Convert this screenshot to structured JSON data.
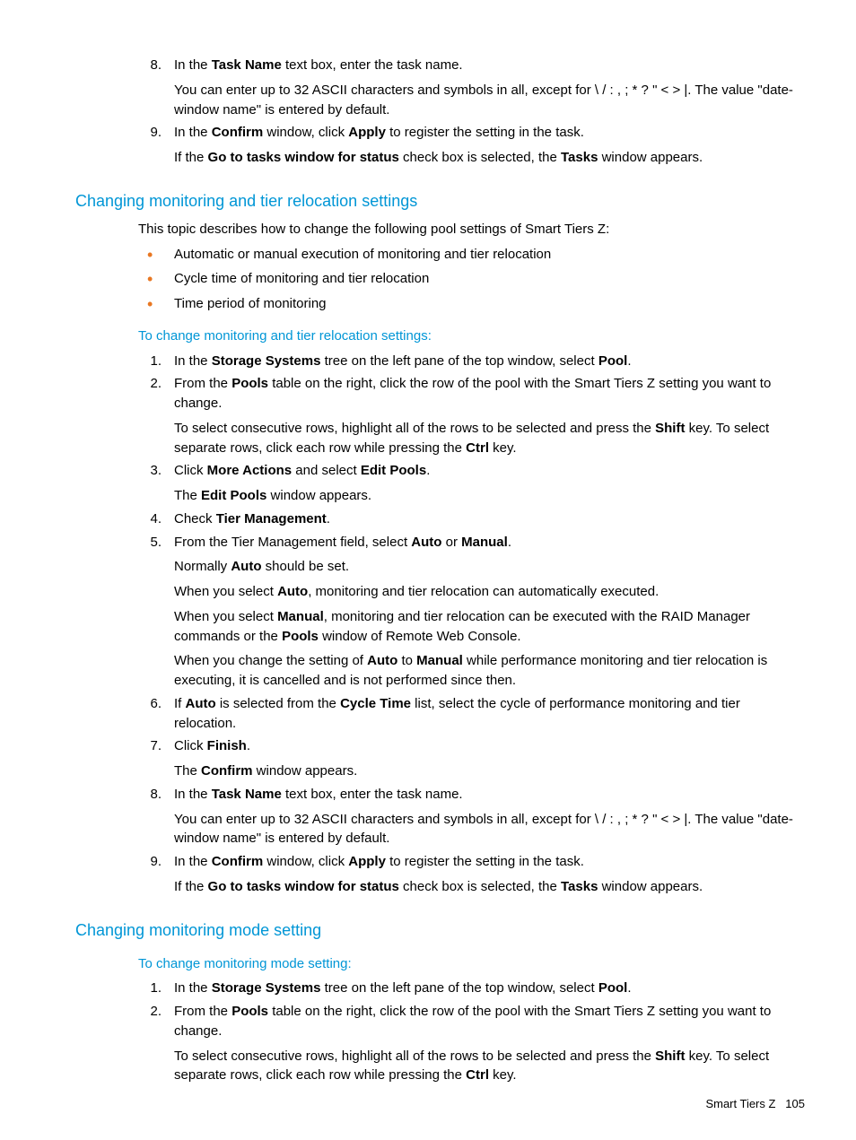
{
  "top_ol": [
    {
      "num": "8",
      "parts": [
        [
          {
            "t": "In the "
          },
          {
            "t": "Task Name",
            "b": true
          },
          {
            "t": " text box, enter the task name."
          }
        ],
        [
          {
            "t": "You can enter up to 32 ASCII characters and symbols in all, except for \\ / : , ; * ? \" < > |. The value \"date-window name\" is entered by default."
          }
        ]
      ]
    },
    {
      "num": "9",
      "parts": [
        [
          {
            "t": "In the "
          },
          {
            "t": "Confirm",
            "b": true
          },
          {
            "t": " window, click "
          },
          {
            "t": "Apply",
            "b": true
          },
          {
            "t": " to register the setting in the task."
          }
        ],
        [
          {
            "t": "If the "
          },
          {
            "t": "Go to tasks window for status",
            "b": true
          },
          {
            "t": " check box is selected, the "
          },
          {
            "t": "Tasks",
            "b": true
          },
          {
            "t": " window appears."
          }
        ]
      ]
    }
  ],
  "section1": {
    "heading": "Changing monitoring and tier relocation settings",
    "intro": "This topic describes how to change the following pool settings of Smart Tiers Z:",
    "bullets": [
      "Automatic or manual execution of monitoring and tier relocation",
      "Cycle time of monitoring and tier relocation",
      "Time period of monitoring"
    ],
    "subhead": "To change monitoring and tier relocation settings:",
    "ol": [
      {
        "num": "1",
        "parts": [
          [
            {
              "t": "In the "
            },
            {
              "t": "Storage Systems",
              "b": true
            },
            {
              "t": " tree on the left pane of the top window, select "
            },
            {
              "t": "Pool",
              "b": true
            },
            {
              "t": "."
            }
          ]
        ]
      },
      {
        "num": "2",
        "parts": [
          [
            {
              "t": "From the "
            },
            {
              "t": "Pools",
              "b": true
            },
            {
              "t": " table on the right, click the row of the pool with the Smart Tiers Z setting you want to change."
            }
          ],
          [
            {
              "t": "To select consecutive rows, highlight all of the rows to be selected and press the "
            },
            {
              "t": "Shift",
              "b": true
            },
            {
              "t": " key. To select separate rows, click each row while pressing the "
            },
            {
              "t": "Ctrl",
              "b": true
            },
            {
              "t": " key."
            }
          ]
        ]
      },
      {
        "num": "3",
        "parts": [
          [
            {
              "t": "Click "
            },
            {
              "t": "More Actions",
              "b": true
            },
            {
              "t": " and select "
            },
            {
              "t": "Edit Pools",
              "b": true
            },
            {
              "t": "."
            }
          ],
          [
            {
              "t": "The "
            },
            {
              "t": "Edit Pools",
              "b": true
            },
            {
              "t": " window appears."
            }
          ]
        ]
      },
      {
        "num": "4",
        "parts": [
          [
            {
              "t": "Check "
            },
            {
              "t": "Tier Management",
              "b": true
            },
            {
              "t": "."
            }
          ]
        ]
      },
      {
        "num": "5",
        "parts": [
          [
            {
              "t": "From the Tier Management field, select "
            },
            {
              "t": "Auto",
              "b": true
            },
            {
              "t": " or "
            },
            {
              "t": "Manual",
              "b": true
            },
            {
              "t": "."
            }
          ],
          [
            {
              "t": "Normally "
            },
            {
              "t": "Auto",
              "b": true
            },
            {
              "t": " should be set."
            }
          ],
          [
            {
              "t": "When you select "
            },
            {
              "t": "Auto",
              "b": true
            },
            {
              "t": ", monitoring and tier relocation can automatically executed."
            }
          ],
          [
            {
              "t": "When you select "
            },
            {
              "t": "Manual",
              "b": true
            },
            {
              "t": ", monitoring and tier relocation can be executed with the RAID Manager commands or the "
            },
            {
              "t": "Pools",
              "b": true
            },
            {
              "t": " window of Remote Web Console."
            }
          ],
          [
            {
              "t": "When you change the setting of "
            },
            {
              "t": "Auto",
              "b": true
            },
            {
              "t": " to "
            },
            {
              "t": "Manual",
              "b": true
            },
            {
              "t": " while performance monitoring and tier relocation is executing, it is cancelled and is not performed since then."
            }
          ]
        ]
      },
      {
        "num": "6",
        "parts": [
          [
            {
              "t": "If "
            },
            {
              "t": "Auto",
              "b": true
            },
            {
              "t": " is selected from the "
            },
            {
              "t": "Cycle Time",
              "b": true
            },
            {
              "t": " list, select the cycle of performance monitoring and tier relocation."
            }
          ]
        ]
      },
      {
        "num": "7",
        "parts": [
          [
            {
              "t": "Click "
            },
            {
              "t": "Finish",
              "b": true
            },
            {
              "t": "."
            }
          ],
          [
            {
              "t": "The "
            },
            {
              "t": "Confirm",
              "b": true
            },
            {
              "t": " window appears."
            }
          ]
        ]
      },
      {
        "num": "8",
        "parts": [
          [
            {
              "t": "In the "
            },
            {
              "t": "Task Name",
              "b": true
            },
            {
              "t": " text box, enter the task name."
            }
          ],
          [
            {
              "t": "You can enter up to 32 ASCII characters and symbols in all, except for \\ / : , ; * ? \" < > |. The value \"date-window name\" is entered by default."
            }
          ]
        ]
      },
      {
        "num": "9",
        "parts": [
          [
            {
              "t": "In the "
            },
            {
              "t": "Confirm",
              "b": true
            },
            {
              "t": " window, click "
            },
            {
              "t": "Apply",
              "b": true
            },
            {
              "t": " to register the setting in the task."
            }
          ],
          [
            {
              "t": "If the "
            },
            {
              "t": "Go to tasks window for status",
              "b": true
            },
            {
              "t": " check box is selected, the "
            },
            {
              "t": "Tasks",
              "b": true
            },
            {
              "t": " window appears."
            }
          ]
        ]
      }
    ]
  },
  "section2": {
    "heading": "Changing monitoring mode setting",
    "subhead": "To change monitoring mode setting:",
    "ol": [
      {
        "num": "1",
        "parts": [
          [
            {
              "t": "In the "
            },
            {
              "t": "Storage Systems",
              "b": true
            },
            {
              "t": " tree on the left pane of the top window, select "
            },
            {
              "t": "Pool",
              "b": true
            },
            {
              "t": "."
            }
          ]
        ]
      },
      {
        "num": "2",
        "parts": [
          [
            {
              "t": "From the "
            },
            {
              "t": "Pools",
              "b": true
            },
            {
              "t": " table on the right, click the row of the pool with the Smart Tiers Z setting you want to change."
            }
          ],
          [
            {
              "t": "To select consecutive rows, highlight all of the rows to be selected and press the "
            },
            {
              "t": "Shift",
              "b": true
            },
            {
              "t": " key. To select separate rows, click each row while pressing the "
            },
            {
              "t": "Ctrl",
              "b": true
            },
            {
              "t": " key."
            }
          ]
        ]
      }
    ]
  },
  "footer": {
    "label": "Smart Tiers Z",
    "page": "105"
  }
}
